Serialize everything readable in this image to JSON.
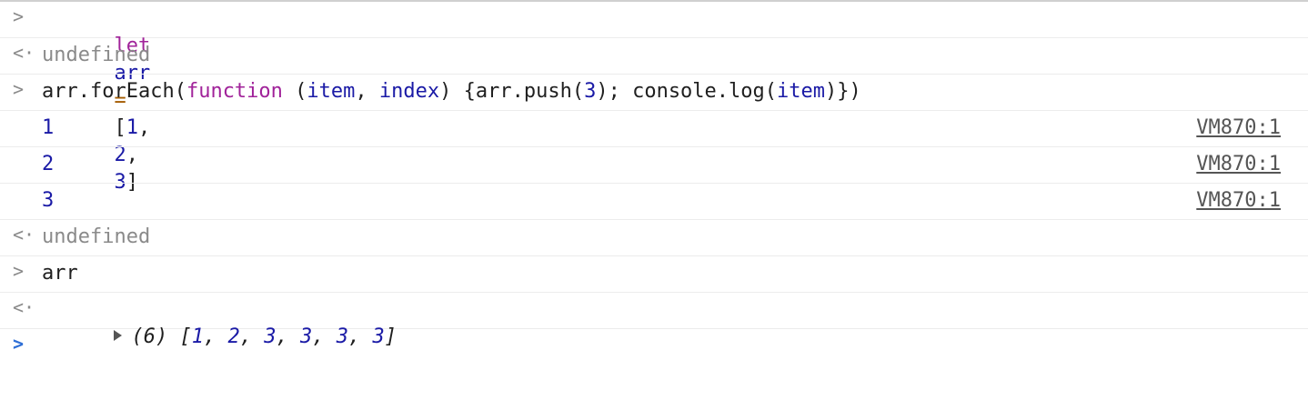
{
  "lines": {
    "l1": {
      "kw": "let",
      "var": "arr",
      "eq": "=",
      "open": "[",
      "n1": "1",
      "c1": ",",
      "n2": "2",
      "c2": ",",
      "n3": "3",
      "close": "]"
    },
    "l2": {
      "text": "undefined"
    },
    "l3": {
      "a": "arr.forEach(",
      "kw": "function",
      "b": " (",
      "item1": "item",
      "c": ", ",
      "index": "index",
      "d": ") {arr.push(",
      "num3": "3",
      "e": "); console.log(",
      "item2": "item",
      "f": ")})"
    },
    "l4": {
      "text": "1",
      "src": "VM870:1"
    },
    "l5": {
      "text": "2",
      "src": "VM870:1"
    },
    "l6": {
      "text": "3",
      "src": "VM870:1"
    },
    "l7": {
      "text": "undefined"
    },
    "l8": {
      "text": "arr"
    },
    "l9": {
      "count": "(6)",
      "open": "[",
      "n1": "1",
      "n2": "2",
      "n3": "3",
      "n4": "3",
      "n5": "3",
      "n6": "3",
      "sep": ", ",
      "close": "]"
    }
  },
  "icons": {
    "input_prompt": "chevron-right-icon",
    "result_prompt": "return-arrow-icon",
    "expand": "triangle-right-icon"
  },
  "colors": {
    "keyword": "#a1239a",
    "number": "#1a1aa6",
    "undefined": "#8a8a8a",
    "prompt_active": "#2f6fd6"
  }
}
